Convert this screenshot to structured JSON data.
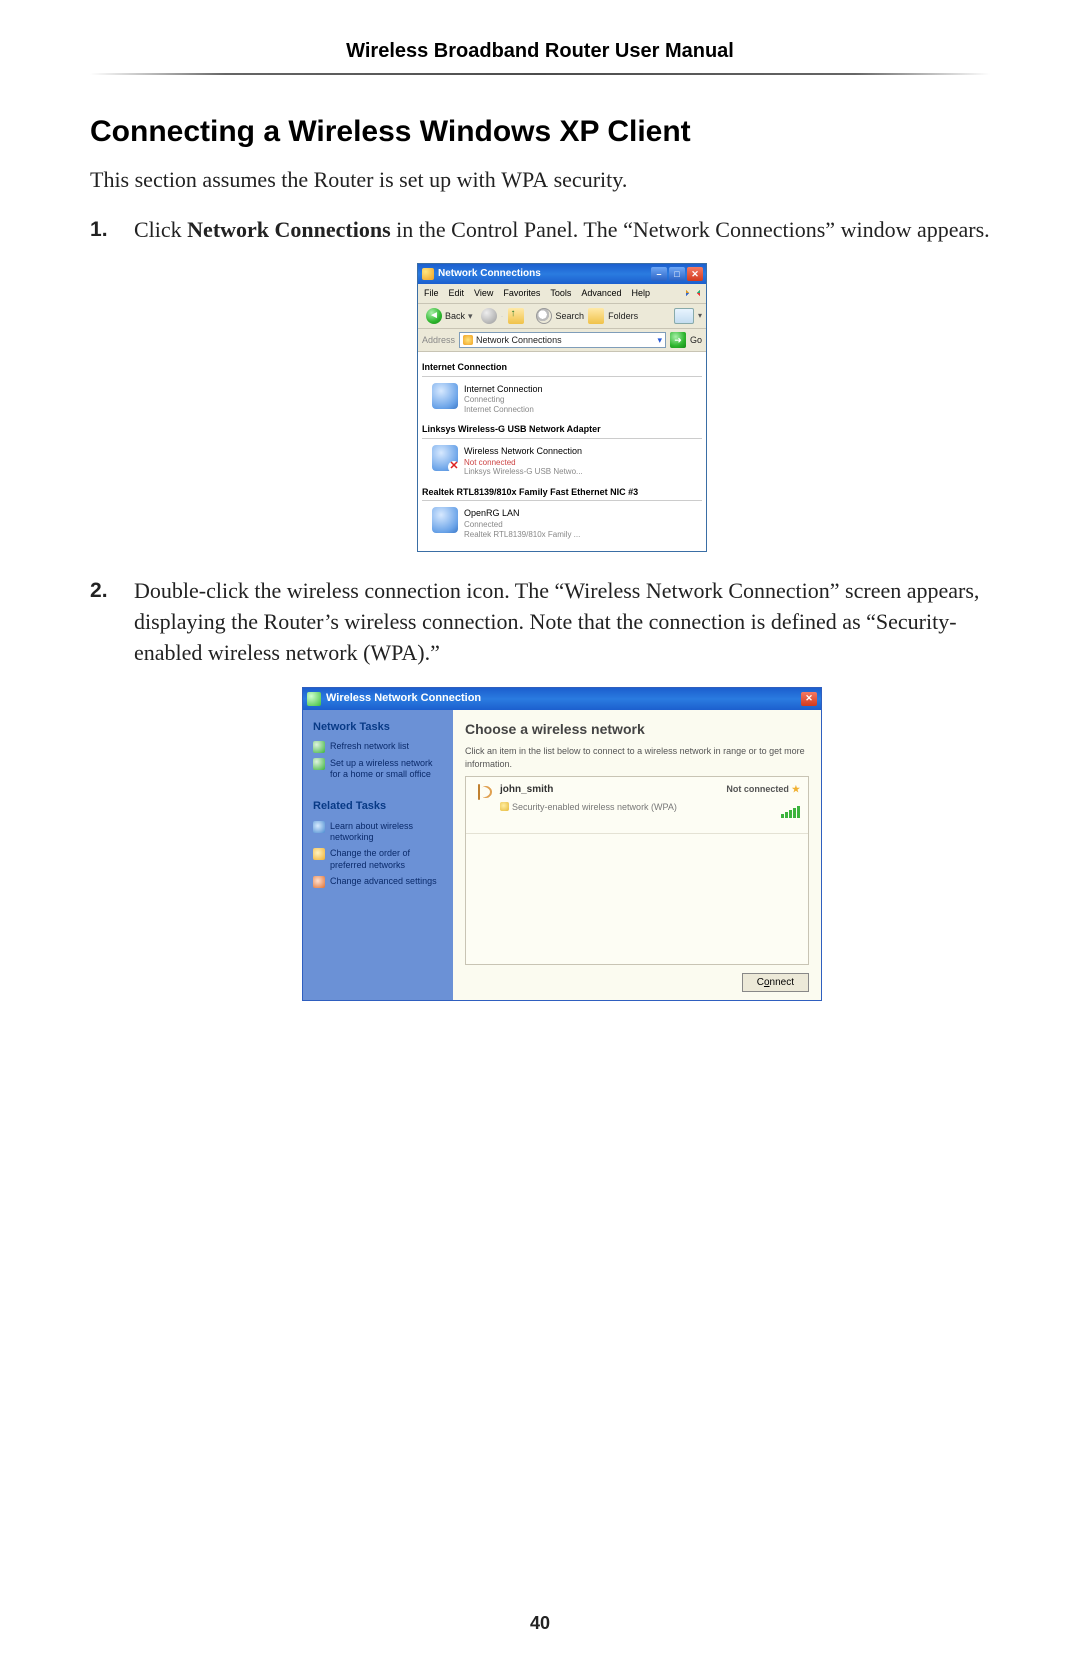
{
  "header": {
    "title": "Wireless Broadband Router User Manual"
  },
  "section": {
    "title": "Connecting a Wireless Windows XP Client"
  },
  "intro": {
    "pre": "This section assumes the Router is set up with ",
    "wpa": "WPA",
    "post": " security."
  },
  "step1": {
    "pre": "Click ",
    "bold": "Network Connections",
    "post": " in the Control Panel. The “Network Connections” window appears."
  },
  "step2": {
    "text": "Double-click the wireless connection icon. The “Wireless Network Connection” screen appears, displaying the Router’s wireless connection. Note that the connection is defined as “Security-enabled wireless network (",
    "wpa": "WPA",
    "post": ").”"
  },
  "nc": {
    "title": "Network Connections",
    "menu": {
      "file": "File",
      "edit": "Edit",
      "view": "View",
      "favorites": "Favorites",
      "tools": "Tools",
      "advanced": "Advanced",
      "help": "Help"
    },
    "toolbar": {
      "back": "Back",
      "search": "Search",
      "folders": "Folders"
    },
    "address": {
      "label": "Address",
      "value": "Network Connections",
      "go": "Go"
    },
    "groups": [
      {
        "header": "Internet Connection",
        "item": {
          "title": "Internet Connection",
          "line1": "Connecting",
          "line2": "Internet Connection",
          "redx": false
        }
      },
      {
        "header": "Linksys Wireless-G USB Network Adapter",
        "item": {
          "title": "Wireless Network Connection",
          "line1": "Not connected",
          "line2": "Linksys Wireless-G USB Netwo...",
          "redx": true
        }
      },
      {
        "header": "Realtek RTL8139/810x Family Fast Ethernet NIC #3",
        "item": {
          "title": "OpenRG LAN",
          "line1": "Connected",
          "line2": "Realtek RTL8139/810x Family ...",
          "redx": false
        }
      }
    ]
  },
  "wnc": {
    "title": "Wireless Network Connection",
    "side": {
      "h1": "Network Tasks",
      "t1": "Refresh network list",
      "t2": "Set up a wireless network for a home or small office",
      "h2": "Related Tasks",
      "t3": "Learn about wireless networking",
      "t4": "Change the order of preferred networks",
      "t5": "Change advanced settings"
    },
    "main": {
      "heading": "Choose a wireless network",
      "hint": "Click an item in the list below to connect to a wireless network in range or to get more information.",
      "net": {
        "name": "john_smith",
        "security": "Security-enabled wireless network (WPA)",
        "status": "Not connected"
      },
      "connect_pre": "C",
      "connect_u": "o",
      "connect_post": "nnect"
    }
  },
  "pageNumber": "40"
}
